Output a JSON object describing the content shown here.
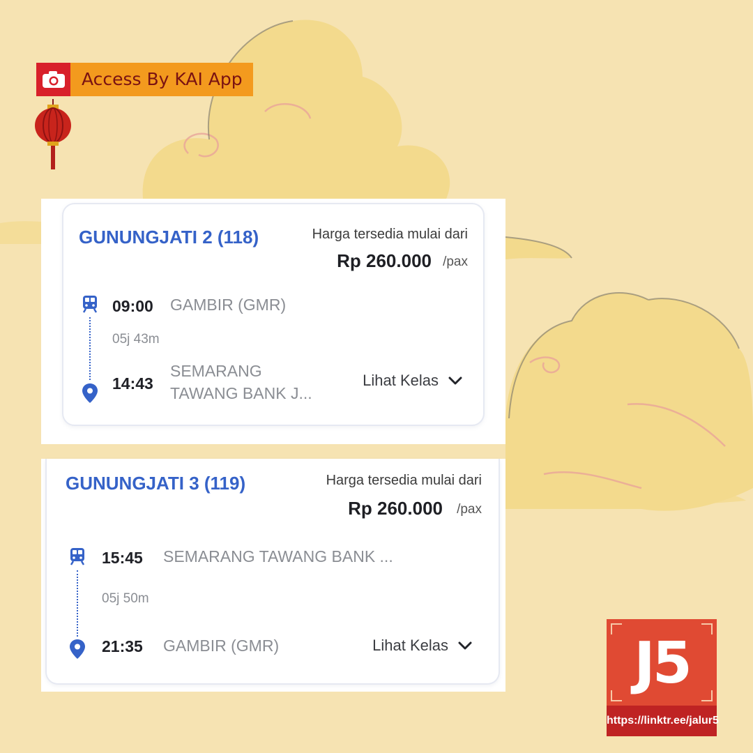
{
  "colors": {
    "background": "#f6e3b2",
    "accent_blue": "#3562c8",
    "badge_red": "#d8202a",
    "badge_orange": "#f39a1e",
    "logo_red": "#e04a33"
  },
  "badge": {
    "icon": "camera-icon",
    "label": "Access By KAI App"
  },
  "trains": [
    {
      "name": "GUNUNGJATI 2 (118)",
      "price_caption": "Harga tersedia mulai dari",
      "price": "Rp 260.000",
      "price_unit": "/pax",
      "depart_time": "09:00",
      "depart_station": "GAMBIR (GMR)",
      "duration": "05j 43m",
      "arrive_time": "14:43",
      "arrive_station_line1": "SEMARANG",
      "arrive_station_line2": "TAWANG BANK J...",
      "action_label": "Lihat Kelas"
    },
    {
      "name": "GUNUNGJATI 3 (119)",
      "price_caption": "Harga tersedia mulai dari",
      "price": "Rp 260.000",
      "price_unit": "/pax",
      "depart_time": "15:45",
      "depart_station": "SEMARANG TAWANG BANK ...",
      "duration": "05j 50m",
      "arrive_time": "21:35",
      "arrive_station": "GAMBIR (GMR)",
      "action_label": "Lihat Kelas"
    }
  ],
  "logo": {
    "mark": "J5",
    "url": "https://linktr.ee/jalur5"
  }
}
